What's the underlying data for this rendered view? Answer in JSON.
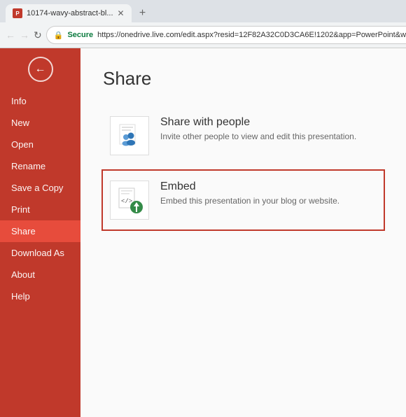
{
  "browser": {
    "tab_label": "10174-wavy-abstract-bl...",
    "new_tab_icon": "+",
    "back_icon": "←",
    "forward_icon": "→",
    "refresh_icon": "↻",
    "secure_label": "Secure",
    "address_url": "https://onedrive.live.com/edit.aspx?resid=12F82A32C0D3CA6E!1202&app=PowerPoint&wdm"
  },
  "sidebar": {
    "back_icon": "←",
    "menu_items": [
      {
        "id": "info",
        "label": "Info",
        "active": false
      },
      {
        "id": "new",
        "label": "New",
        "active": false
      },
      {
        "id": "open",
        "label": "Open",
        "active": false
      },
      {
        "id": "rename",
        "label": "Rename",
        "active": false
      },
      {
        "id": "save-a-copy",
        "label": "Save a Copy",
        "active": false
      },
      {
        "id": "print",
        "label": "Print",
        "active": false
      },
      {
        "id": "share",
        "label": "Share",
        "active": true
      },
      {
        "id": "download-as",
        "label": "Download As",
        "active": false
      },
      {
        "id": "about",
        "label": "About",
        "active": false
      },
      {
        "id": "help",
        "label": "Help",
        "active": false
      }
    ]
  },
  "main": {
    "title": "Share",
    "share_cards": [
      {
        "id": "share-with-people",
        "title": "Share with people",
        "description": "Invite other people to view and edit this presentation.",
        "selected": false
      },
      {
        "id": "embed",
        "title": "Embed",
        "description": "Embed this presentation in your blog or website.",
        "selected": true
      }
    ]
  }
}
